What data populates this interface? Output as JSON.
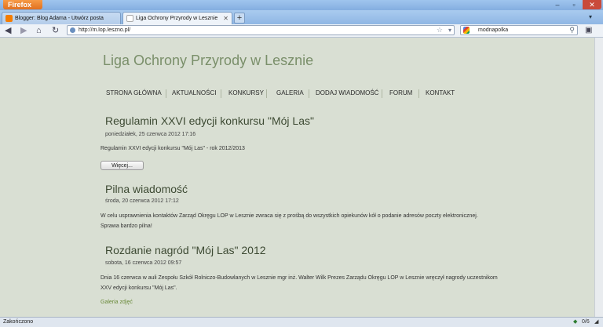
{
  "browser": {
    "app_button": "Firefox",
    "tabs": [
      {
        "label": "Blogger: Blog Adama - Utwórz posta",
        "active": false
      },
      {
        "label": "Liga Ochrony Przyrody w Lesznie",
        "active": true
      }
    ],
    "url": "http://m.lop.leszno.pl/",
    "search_engine_text": "modnapolka",
    "status_text": "Zakończono",
    "status_right": "0/6"
  },
  "colors": {
    "page_bg": "#d9dfd3",
    "site_title": "#7a8f6a",
    "post_title": "#3d4a33",
    "link": "#6a8a3a",
    "firefox_orange": "#e0701f"
  },
  "site": {
    "title": "Liga Ochrony Przyrody w Lesznie",
    "nav": [
      "STRONA GŁÓWNA",
      "AKTUALNOŚCI",
      "KONKURSY",
      "GALERIA",
      "DODAJ WIADOMOŚĆ",
      "FORUM",
      "KONTAKT"
    ]
  },
  "posts": [
    {
      "title": "Regulamin XXVI edycji konkursu \"Mój Las\"",
      "date": "poniedziałek, 25 czerwca 2012 17:16",
      "text": "Regulamin XXVI edycji konkursu \"Mój Las\" - rok 2012/2013",
      "more_label": "Więcej..."
    },
    {
      "title": "Pilna wiadomość",
      "date": "środa, 20 czerwca 2012 17:12",
      "text": "W celu usprawnienia kontaktów Zarząd Okręgu LOP w Lesznie zwraca się z prośbą do wszystkich opiekunów kół o podanie adresów poczty elektronicznej. Sprawa bardzo pilna!"
    },
    {
      "title": "Rozdanie nagród \"Mój Las\" 2012",
      "date": "sobota, 16 czerwca 2012 09:57",
      "text": "Dnia 16 czerwca w auli Zespołu Szkół Rolniczo-Budowlanych w Lesznie mgr inż. Walter Wilk Prezes Zarządu Okręgu LOP w Lesznie wręczył nagrody uczestnikom XXV edycji konkursu \"Mój Las\".",
      "link_label": "Galeria zdjęć"
    }
  ]
}
